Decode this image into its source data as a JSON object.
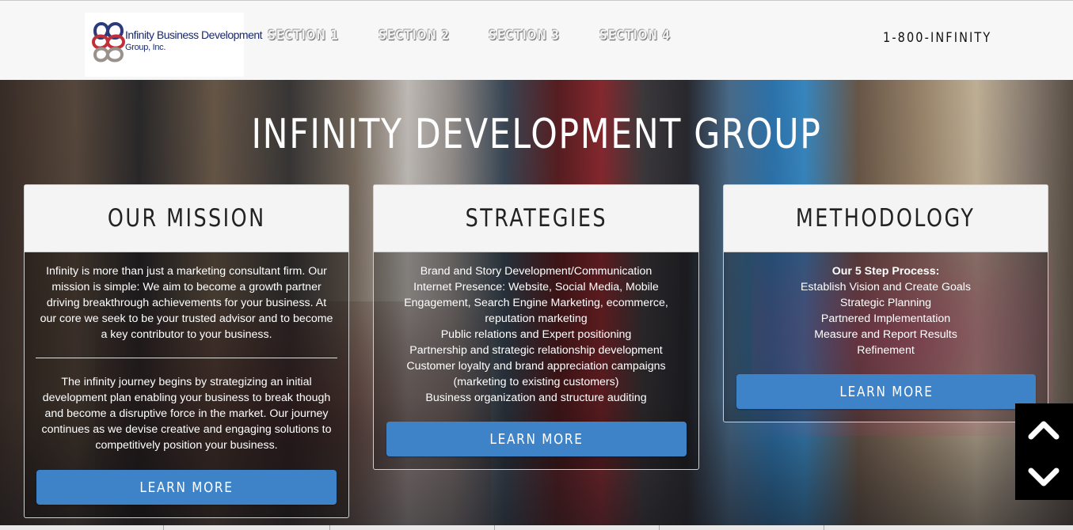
{
  "header": {
    "logo": {
      "name": "Infinity Business Development",
      "sub": "Group, Inc."
    },
    "nav": [
      {
        "label": "SECTION 1"
      },
      {
        "label": "SECTION 2"
      },
      {
        "label": "SECTION 3"
      },
      {
        "label": "SECTION 4"
      }
    ],
    "phone": "1-800-INFINITY"
  },
  "hero": {
    "title": "INFINITY DEVELOPMENT GROUP"
  },
  "cards": {
    "mission": {
      "title": "OUR MISSION",
      "para1": [
        "Infinity is more than just a marketing consultant firm. Our",
        "mission is simple: We aim to become a growth partner",
        "driving breakthrough achievements for your business. At",
        "our core we seek to be your trusted advisor and to become",
        "a key contributor to your business."
      ],
      "para2": [
        "The infinity journey begins by strategizing an initial",
        "development plan enabling your business to break though",
        "and become a disruptive force in the market. Our journey",
        "continues as we devise creative and engaging solutions to",
        "competitively position your business."
      ],
      "button": "LEARN MORE"
    },
    "strategies": {
      "title": "STRATEGIES",
      "lines": [
        "Brand and Story Development/Communication",
        "Internet Presence: Website, Social Media, Mobile",
        "Engagement, Search Engine Marketing, ecommerce,",
        "reputation marketing",
        "Public relations and Expert positioning",
        "Partnership and strategic relationship development",
        "Customer loyalty and brand appreciation campaigns",
        "(marketing to existing customers)",
        "Business organization and structure auditing"
      ],
      "button": "LEARN MORE"
    },
    "methodology": {
      "title": "METHODOLOGY",
      "heading": "Our 5 Step Process:",
      "lines": [
        "Establish Vision and Create Goals",
        "Strategic Planning",
        "Partnered Implementation",
        "Measure and Report Results",
        "Refinement"
      ],
      "button": "LEARN MORE"
    }
  },
  "scroll": {
    "up_icon": "chevron-up-icon",
    "down_icon": "chevron-down-icon"
  },
  "colors": {
    "button": "#3e83c8",
    "header_bg": "#f7f7f7",
    "card_head_bg": "#f4f4f4"
  }
}
